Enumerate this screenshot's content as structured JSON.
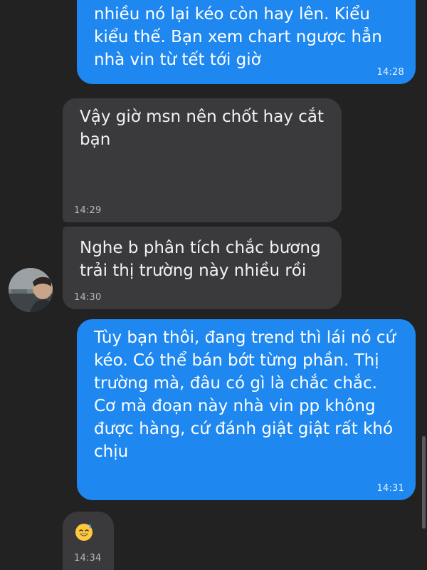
{
  "messages": [
    {
      "direction": "outgoing",
      "text": "nhiều nó lại kéo còn hay lên. Kiểu\nkiểu thế. Bạn xem chart  ngược hẳn\nnhà vin từ tết tới giờ",
      "time": "14:28"
    },
    {
      "direction": "incoming",
      "text": "Vậy giờ msn nên chốt hay cắt\nbạn",
      "time": "14:29"
    },
    {
      "direction": "incoming",
      "text": "Nghe b phân tích chắc bương\ntrải thị trường này nhiều rồi",
      "time": "14:30"
    },
    {
      "direction": "outgoing",
      "text": "Tùy bạn thôi, đang trend thì lái nó cứ\nkéo.  Có thể bán bớt từng phần.  Thị\ntrường mà, đâu có gì là chắc chắc.\nCơ mà đoạn này nhà vin pp không\nđược hàng, cứ đánh giật giật rất khó\nchịu",
      "time": "14:31"
    },
    {
      "direction": "incoming",
      "emoji": "sweat-smile-emoji",
      "time": "14:34"
    }
  ],
  "contact": {
    "avatar_icon": "avatar"
  },
  "colors": {
    "background": "#222222",
    "outgoing_bubble": "#1e88f0",
    "incoming_bubble": "#3a3a3c"
  }
}
